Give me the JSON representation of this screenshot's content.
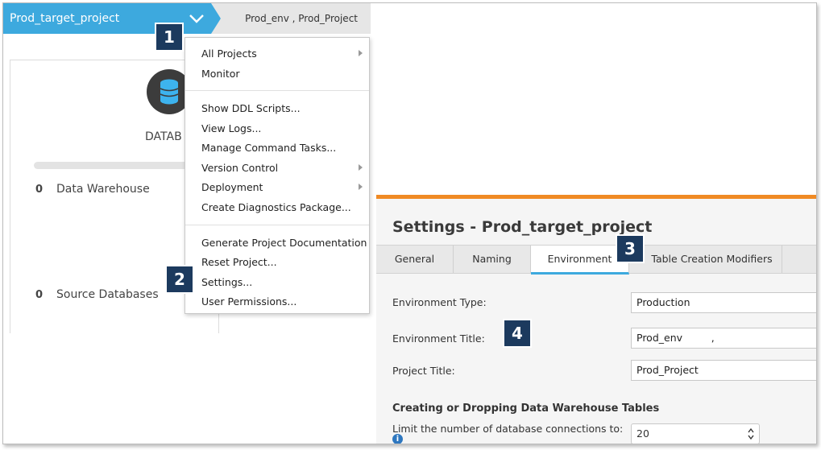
{
  "header": {
    "project_name": "Prod_target_project",
    "environment_label": "Prod_env , Prod_Project"
  },
  "dashboard": {
    "db_label": "DATAB",
    "stats": [
      {
        "count": "0",
        "label": "Data Warehouse"
      },
      {
        "count": "0",
        "label": "Source Databases"
      }
    ]
  },
  "menu": {
    "items": [
      {
        "label": "All Projects",
        "submenu": true
      },
      {
        "label": "Monitor",
        "submenu": false
      },
      {
        "label": "Show DDL Scripts...",
        "submenu": false
      },
      {
        "label": "View Logs...",
        "submenu": false
      },
      {
        "label": "Manage Command Tasks...",
        "submenu": false
      },
      {
        "label": "Version Control",
        "submenu": true
      },
      {
        "label": "Deployment",
        "submenu": true
      },
      {
        "label": "Create Diagnostics Package...",
        "submenu": false
      },
      {
        "label": "Generate Project Documentation",
        "submenu": false
      },
      {
        "label": "Reset Project...",
        "submenu": false
      },
      {
        "label": "Settings...",
        "submenu": false
      },
      {
        "label": "User Permissions...",
        "submenu": false
      }
    ]
  },
  "callouts": [
    "1",
    "2",
    "3",
    "4"
  ],
  "settings": {
    "title": "Settings - Prod_target_project",
    "tabs": [
      "General",
      "Naming",
      "Environment",
      "Table Creation Modifiers"
    ],
    "active_tab": "Environment",
    "fields": {
      "environment_type_label": "Environment Type:",
      "environment_type_value": "Production",
      "environment_title_label": "Environment Title:",
      "environment_title_value": "Prod_env         ,",
      "project_title_label": "Project Title:",
      "project_title_value": "Prod_Project"
    },
    "section_heading": "Creating or Dropping Data Warehouse Tables",
    "connections_label": "Limit the number of database connections to:",
    "connections_value": "20"
  },
  "colors": {
    "header_blue": "#3da9de",
    "badge_navy": "#1c3a5e",
    "accent_orange": "#f08a24"
  }
}
